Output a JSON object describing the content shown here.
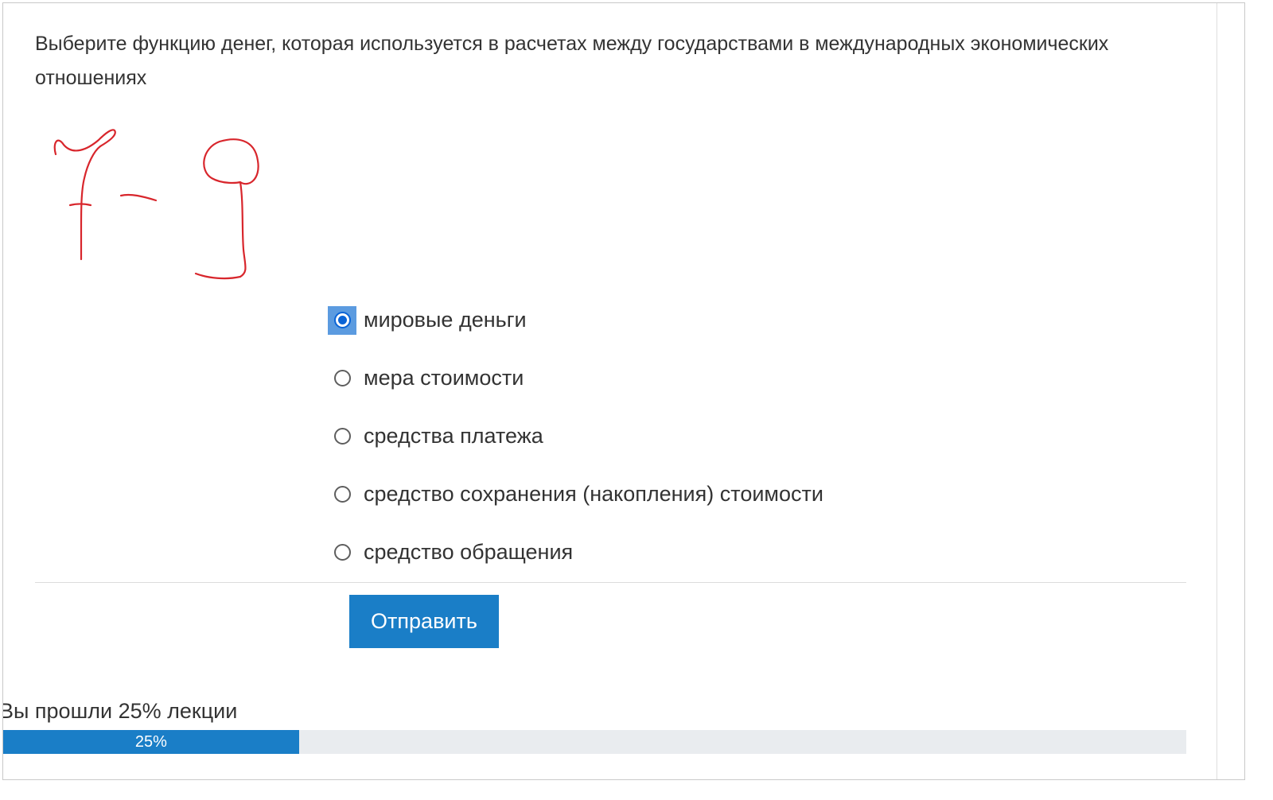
{
  "question": {
    "text": "Выберите функцию денег, которая используется в расчетах между государствами в международных экономических отношениях"
  },
  "annotation": {
    "handwritten_text": "7-9",
    "ink_color": "#d8262c"
  },
  "answers": [
    {
      "label": "мировые деньги",
      "checked": true
    },
    {
      "label": "мера стоимости",
      "checked": false
    },
    {
      "label": "средства платежа",
      "checked": false
    },
    {
      "label": "средство сохранения (накопления) стоимости",
      "checked": false
    },
    {
      "label": "средство обращения",
      "checked": false
    }
  ],
  "submit": {
    "label": "Отправить"
  },
  "progress": {
    "label": "Вы прошли 25% лекции",
    "value_percent": 25,
    "bar_text": "25%"
  },
  "colors": {
    "accent": "#1a7ec7",
    "radio_checked": "#0a64d6",
    "focus_ring": "#5b9be0",
    "track": "#e9ecef"
  }
}
